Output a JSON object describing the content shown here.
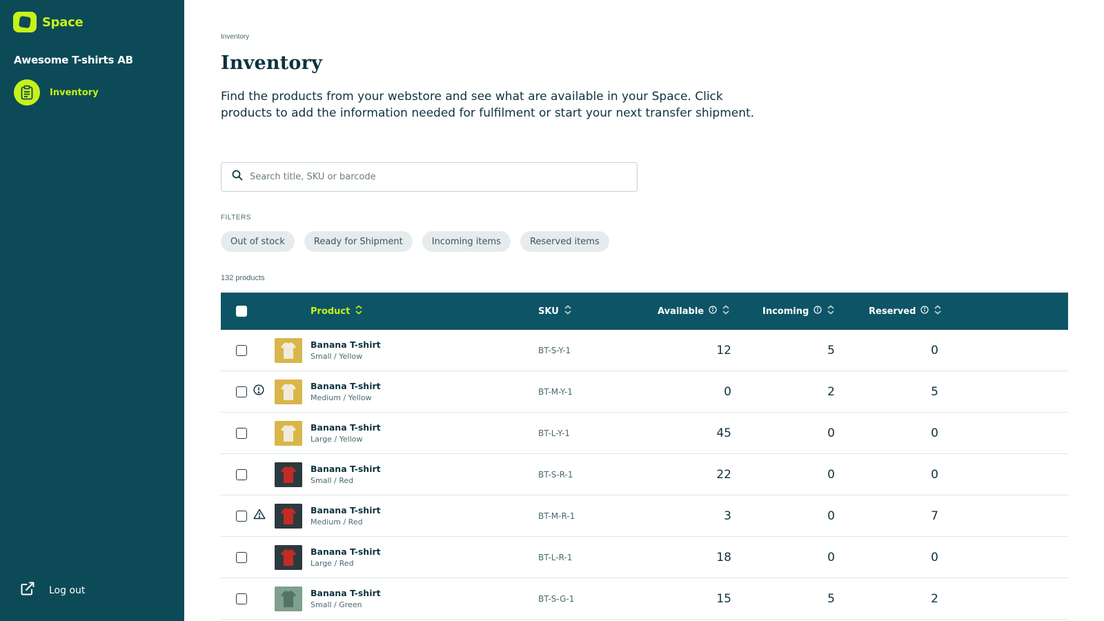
{
  "brand": {
    "name": "Space",
    "accent": "#c6f21a",
    "sidebar_bg": "#0d4a57"
  },
  "org": "Awesome T-shirts AB",
  "nav": {
    "items": [
      {
        "label": "Inventory",
        "icon": "clipboard-icon"
      }
    ]
  },
  "logout": {
    "label": "Log out",
    "icon": "external-link-icon"
  },
  "breadcrumb": "Inventory",
  "page_title": "Inventory",
  "intro": "Find the products from your webstore and see what are available in your Space. Click products to add the information needed for fulfilment or start your next transfer shipment.",
  "search": {
    "placeholder": "Search title, SKU or barcode",
    "value": ""
  },
  "filters": {
    "label": "FILTERS",
    "chips": [
      "Out of stock",
      "Ready for Shipment",
      "Incoming items",
      "Reserved items"
    ]
  },
  "product_count": "132 products",
  "table": {
    "header_bg": "#0d5566",
    "columns": {
      "product": "Product",
      "sku": "SKU",
      "available": "Available",
      "incoming": "Incoming",
      "reserved": "Reserved"
    },
    "rows": [
      {
        "name": "Banana T-shirt",
        "variant": "Small / Yellow",
        "sku": "BT-S-Y-1",
        "available": "12",
        "incoming": "5",
        "reserved": "0",
        "status": "",
        "color": "yellow"
      },
      {
        "name": "Banana T-shirt",
        "variant": "Medium / Yellow",
        "sku": "BT-M-Y-1",
        "available": "0",
        "incoming": "2",
        "reserved": "5",
        "status": "info-circle-icon",
        "color": "yellow"
      },
      {
        "name": "Banana T-shirt",
        "variant": "Large / Yellow",
        "sku": "BT-L-Y-1",
        "available": "45",
        "incoming": "0",
        "reserved": "0",
        "status": "",
        "color": "yellow"
      },
      {
        "name": "Banana T-shirt",
        "variant": "Small / Red",
        "sku": "BT-S-R-1",
        "available": "22",
        "incoming": "0",
        "reserved": "0",
        "status": "",
        "color": "red"
      },
      {
        "name": "Banana T-shirt",
        "variant": "Medium / Red",
        "sku": "BT-M-R-1",
        "available": "3",
        "incoming": "0",
        "reserved": "7",
        "status": "warning-triangle-icon",
        "color": "red"
      },
      {
        "name": "Banana T-shirt",
        "variant": "Large / Red",
        "sku": "BT-L-R-1",
        "available": "18",
        "incoming": "0",
        "reserved": "0",
        "status": "",
        "color": "red"
      },
      {
        "name": "Banana T-shirt",
        "variant": "Small / Green",
        "sku": "BT-S-G-1",
        "available": "15",
        "incoming": "5",
        "reserved": "2",
        "status": "",
        "color": "green"
      }
    ]
  }
}
